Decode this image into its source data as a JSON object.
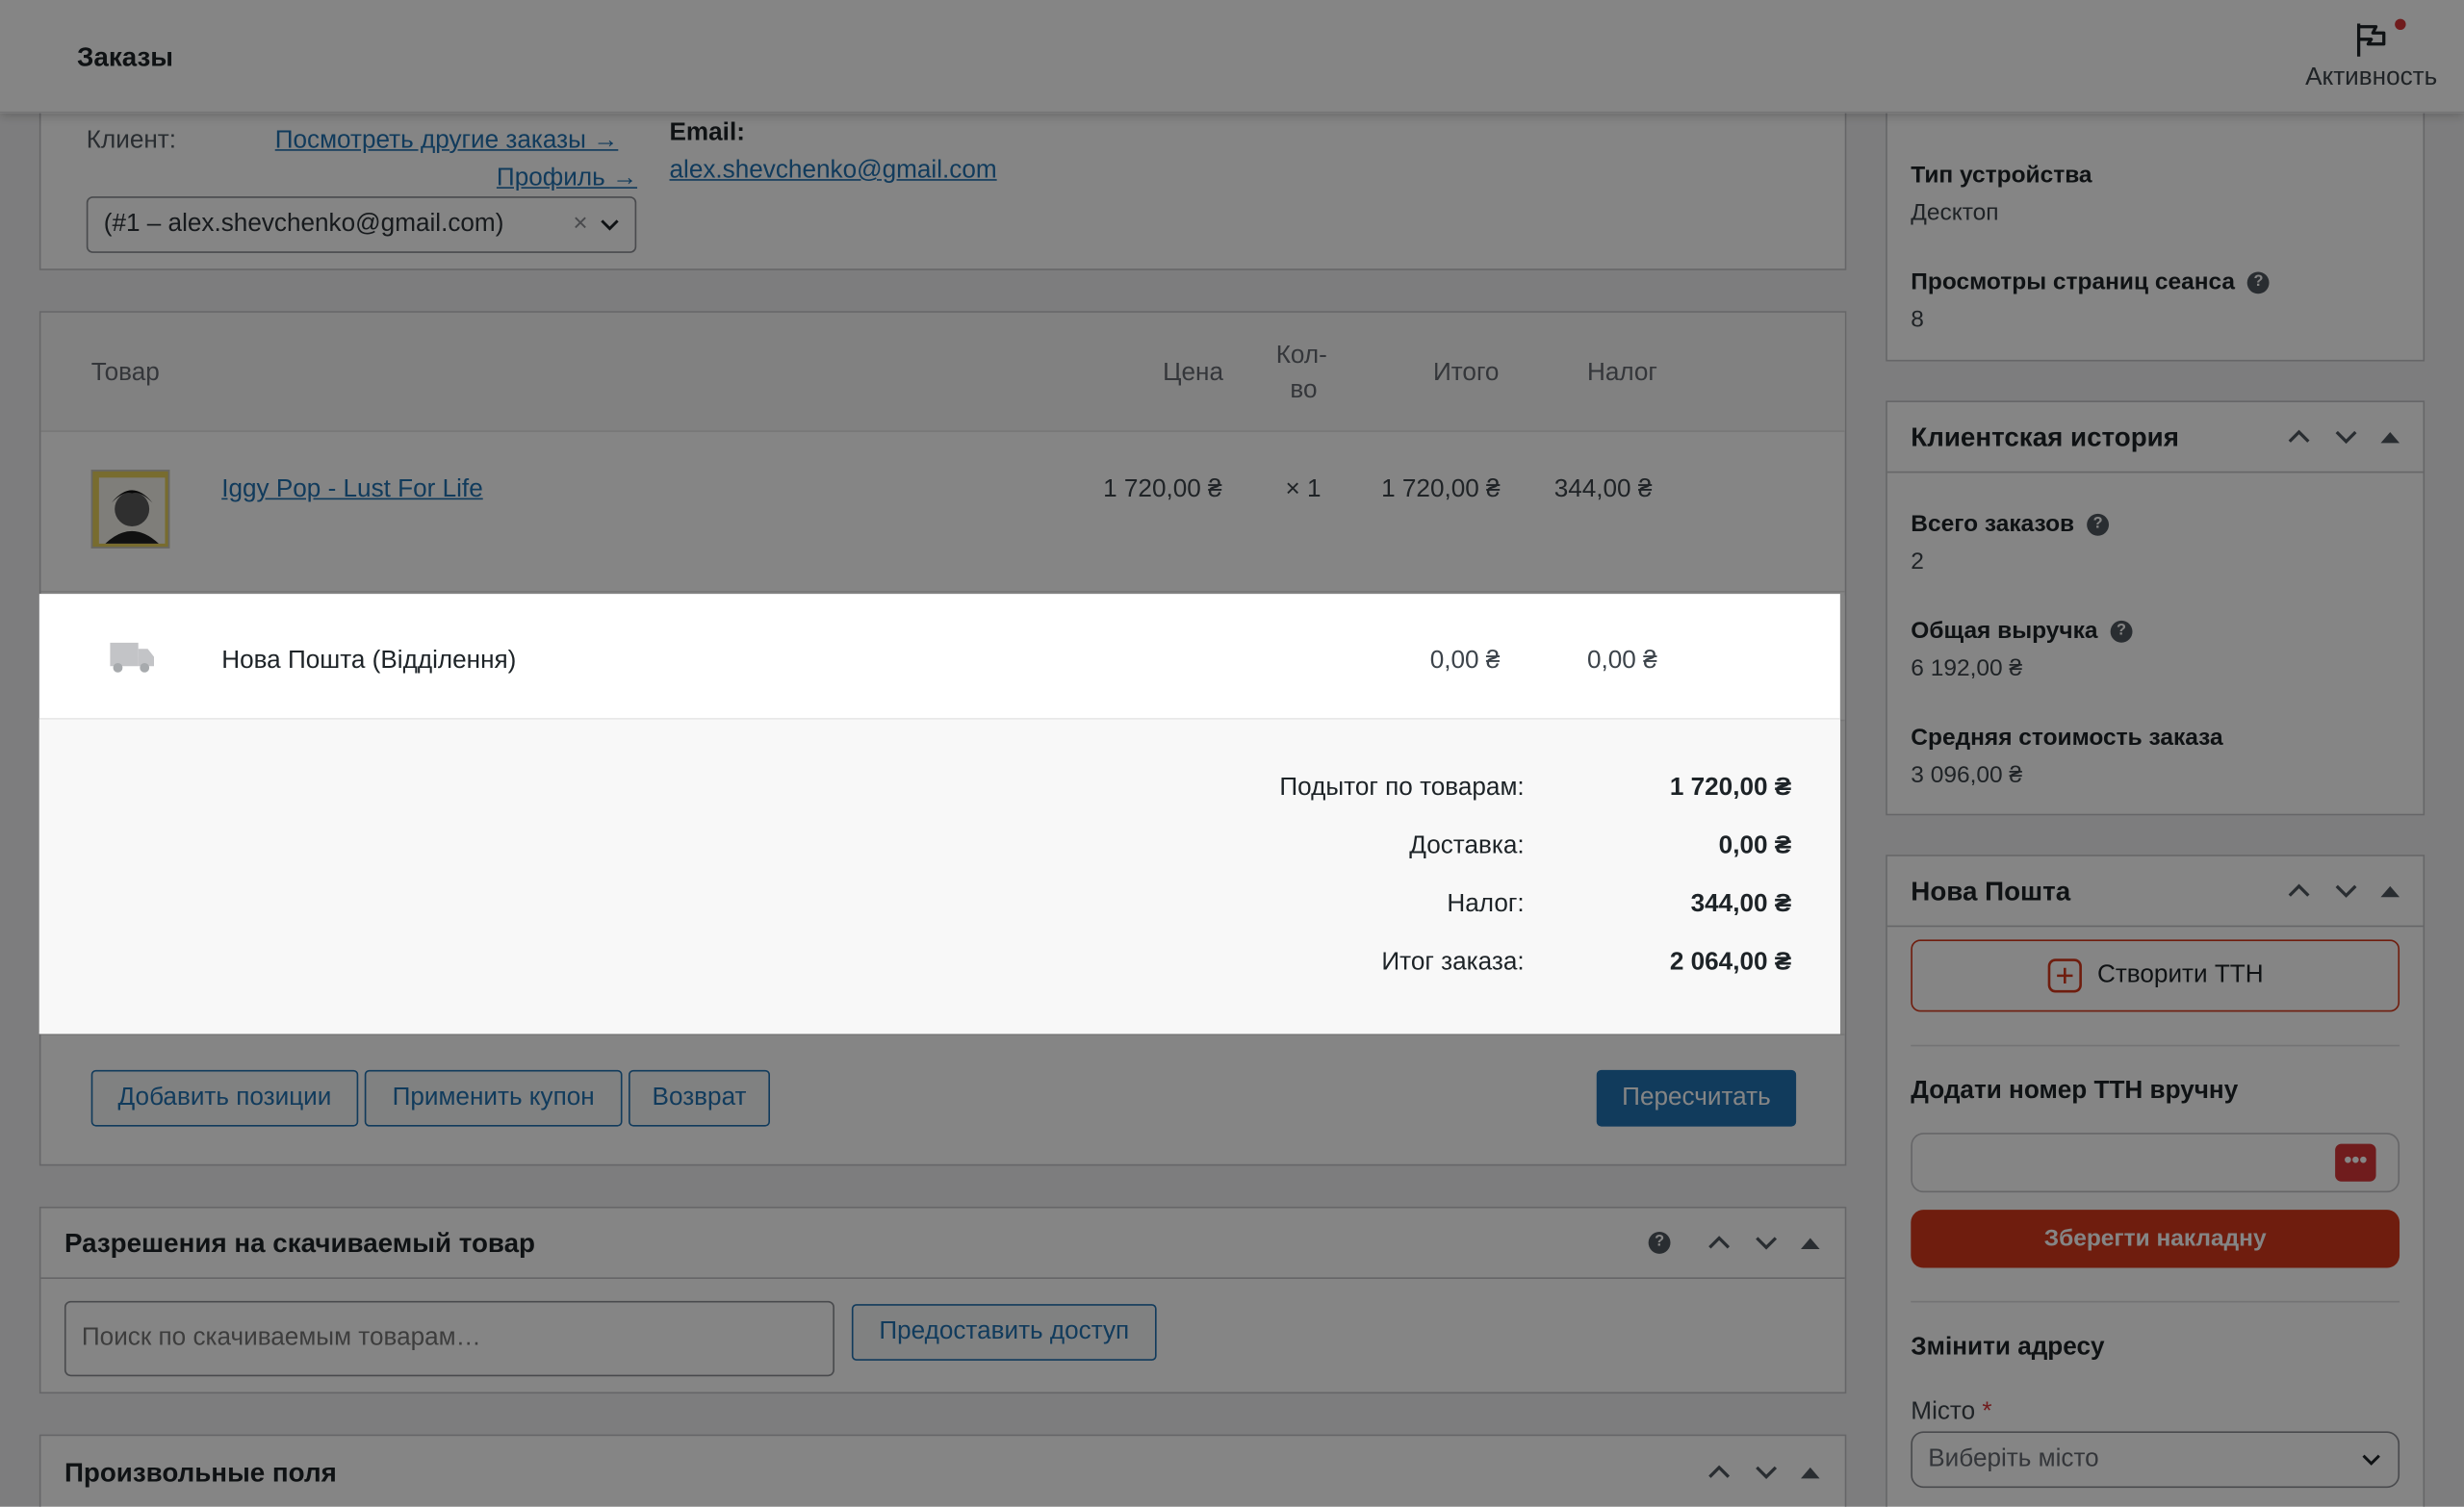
{
  "header": {
    "title": "Заказы",
    "activity_label": "Активность"
  },
  "customer": {
    "label": "Клиент:",
    "other_orders_link": "Посмотреть другие заказы →",
    "profile_link": "Профиль →",
    "select_value": "(#1 – alex.shevchenko@gmail.com)",
    "email_label": "Email:",
    "email_value": "alex.shevchenko@gmail.com"
  },
  "items": {
    "columns": {
      "product": "Товар",
      "price": "Цена",
      "qty_line1": "Кол-",
      "qty_line2": "во",
      "total": "Итого",
      "tax": "Налог"
    },
    "rows": [
      {
        "name": "Iggy Pop - Lust For Life",
        "price": "1 720,00 ₴",
        "qty": "× 1",
        "total": "1 720,00 ₴",
        "tax": "344,00 ₴"
      }
    ],
    "shipping": {
      "name": "Нова Пошта (Відділення)",
      "total": "0,00 ₴",
      "tax": "0,00 ₴"
    }
  },
  "totals": [
    {
      "label": "Подытог по товарам:",
      "value": "1 720,00 ₴"
    },
    {
      "label": "Доставка:",
      "value": "0,00 ₴"
    },
    {
      "label": "Налог:",
      "value": "344,00 ₴"
    },
    {
      "label": "Итог заказа:",
      "value": "2 064,00 ₴"
    }
  ],
  "actions": {
    "add_items": "Добавить позиции",
    "apply_coupon": "Применить купон",
    "refund": "Возврат",
    "recalculate": "Пересчитать"
  },
  "downloads": {
    "title": "Разрешения на скачиваемый товар",
    "search_placeholder": "Поиск по скачиваемым товарам…",
    "grant_button": "Предоставить доступ"
  },
  "custom_fields": {
    "title": "Произвольные поля"
  },
  "sidebar": {
    "attribution": {
      "device_label": "Тип устройства",
      "device_value": "Десктоп",
      "pageviews_label": "Просмотры страниц сеанса",
      "pageviews_value": "8"
    },
    "history": {
      "title": "Клиентская история",
      "total_orders_label": "Всего заказов",
      "total_orders_value": "2",
      "revenue_label": "Общая выручка",
      "revenue_value": "6 192,00 ₴",
      "avg_label": "Средняя стоимость заказа",
      "avg_value": "3 096,00 ₴"
    },
    "novaposhta": {
      "title": "Нова Пошта",
      "create_ttn": "Створити ТТН",
      "manual_ttn_label": "Додати номер ТТН вручну",
      "save_button": "Зберегти накладну",
      "change_address": "Змінити адресу",
      "city_label": "Місто",
      "city_required": "*",
      "city_placeholder": "Виберіть місто"
    }
  },
  "colors": {
    "accent": "#2271b1",
    "nova_poshta": "#d5391c",
    "required": "#d63638",
    "badge": "#d63638"
  }
}
